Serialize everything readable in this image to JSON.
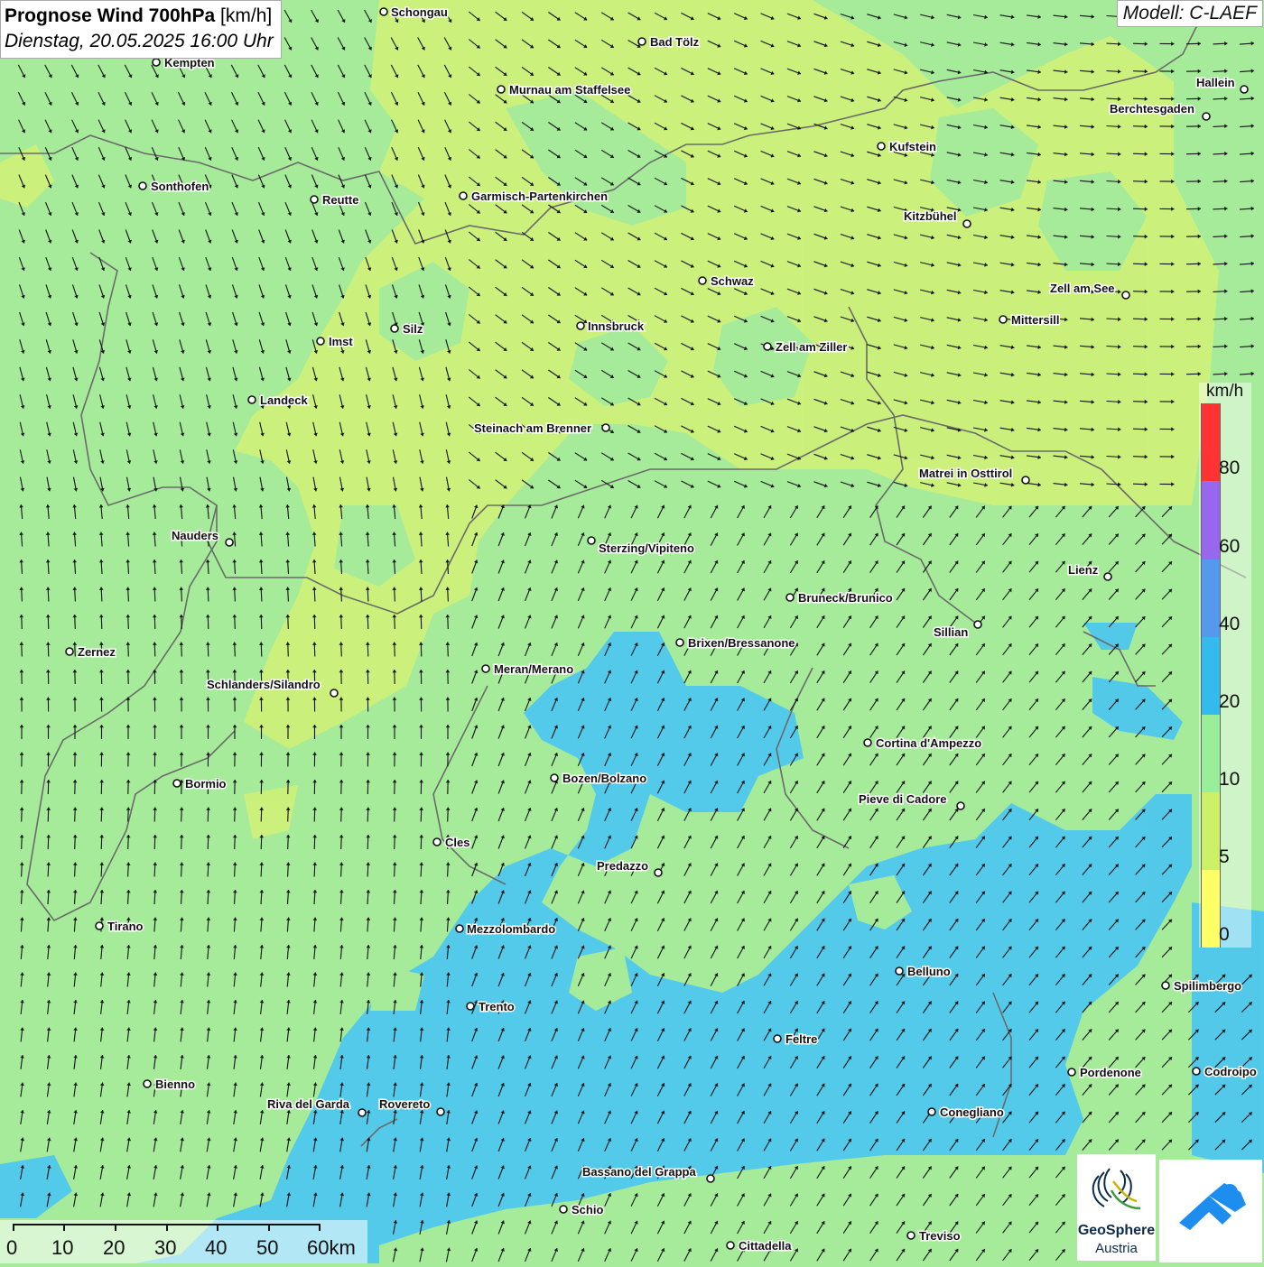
{
  "header": {
    "title_bold": "Prognose Wind 700hPa",
    "title_unit": "[km/h]",
    "subtitle": "Dienstag, 20.05.2025 16:00 Uhr",
    "model": "Modell: C-LAEF"
  },
  "legend": {
    "unit": "km/h",
    "bands": [
      {
        "value": "80",
        "color": "#ff3333"
      },
      {
        "value": "60",
        "color": "#9966ee"
      },
      {
        "value": "40",
        "color": "#5599ee"
      },
      {
        "value": "20",
        "color": "#33bbee"
      },
      {
        "value": "10",
        "color": "#99ee99"
      },
      {
        "value": "5",
        "color": "#ccf066"
      },
      {
        "value": "0",
        "color": "#ffff66"
      }
    ]
  },
  "scalebar": {
    "labels": [
      "0",
      "10",
      "20",
      "30",
      "40",
      "50",
      "60km"
    ]
  },
  "logo": {
    "name": "GeoSphere",
    "sub": "Austria"
  },
  "cities": [
    "Schongau",
    "Bad Tölz",
    "Kempten",
    "Murnau am Staffelsee",
    "Hallein",
    "Berchtesgaden",
    "Kufstein",
    "Sonthofen",
    "Reutte",
    "Garmisch-Partenkirchen",
    "Kitzbühel",
    "Schwaz",
    "Zell am See",
    "Mittersill",
    "Innsbruck",
    "Silz",
    "Imst",
    "Zell am Ziller",
    "Landeck",
    "Steinach am Brenner",
    "Matrei in Osttirol",
    "Nauders",
    "Sterzing/Vipiteno",
    "Lienz",
    "Bruneck/Brunico",
    "Sillian",
    "Zernez",
    "Brixen/Bressanone",
    "Meran/Merano",
    "Schlanders/Silandro",
    "Cortina d'Ampezzo",
    "Bozen/Bolzano",
    "Bormio",
    "Pieve di Cadore",
    "Cles",
    "Predazzo",
    "Tirano",
    "Mezzolombardo",
    "Belluno",
    "Spilimbergo",
    "Trento",
    "Feltre",
    "Bienno",
    "Riva del Garda",
    "Rovereto",
    "Pordenone",
    "Codroipo",
    "Conegliano",
    "Bassano del Grappa",
    "Schio",
    "Treviso",
    "Cittadella"
  ],
  "colors": {
    "calm_green": "#a6eb9a",
    "light_yellowgreen": "#cdf07a",
    "sky_blue": "#4fc8ee",
    "arrow": "#111111",
    "border": "#6a6a6a"
  }
}
